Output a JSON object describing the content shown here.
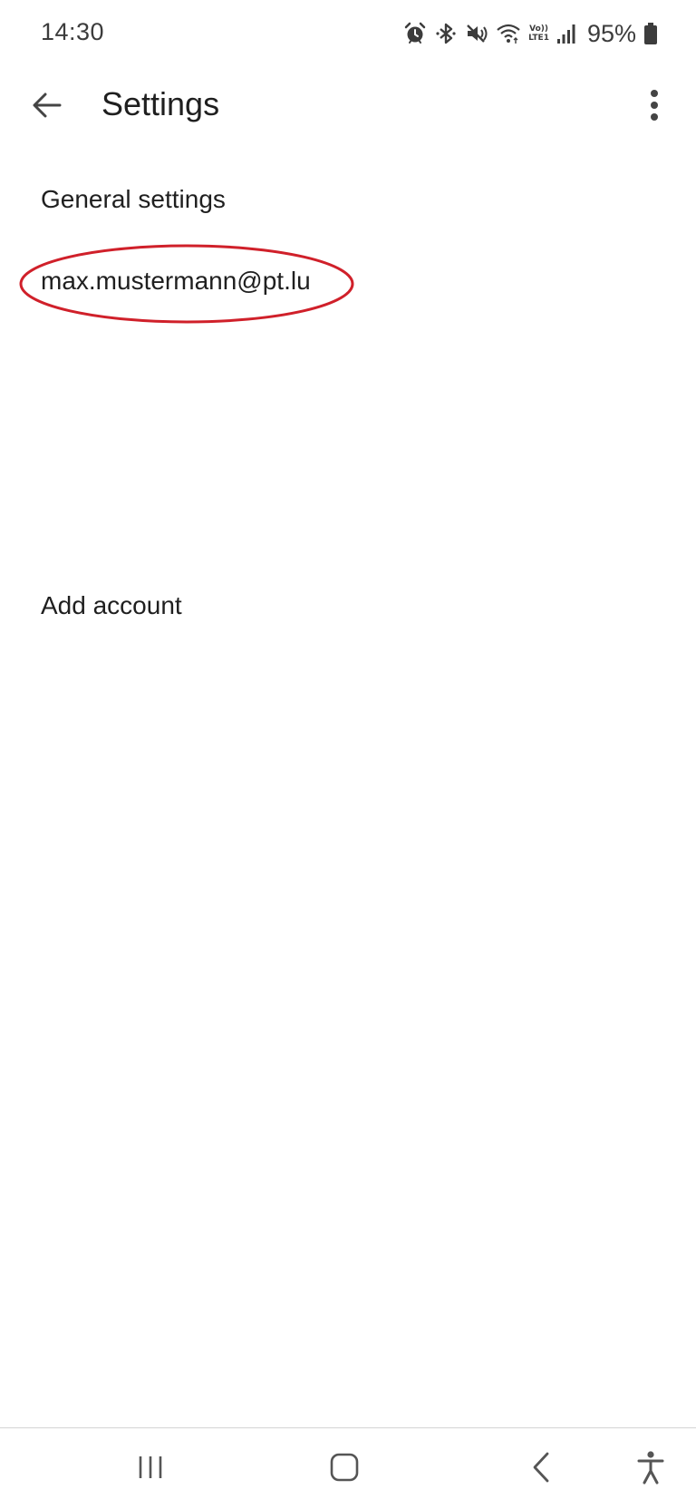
{
  "status_bar": {
    "time": "14:30",
    "battery_percent": "95%",
    "volte_label_top": "Vo))",
    "volte_label_bottom": "LTE1",
    "icons": [
      "alarm-icon",
      "bluetooth-icon",
      "mute-icon",
      "wifi-icon",
      "volte-icon",
      "signal-icon",
      "battery-icon"
    ]
  },
  "app_bar": {
    "title": "Settings",
    "back_icon": "arrow-left-icon",
    "more_icon": "more-vertical-icon"
  },
  "settings_list": {
    "items": [
      {
        "label": "General settings"
      },
      {
        "label": "max.mustermann@pt.lu",
        "highlighted": true,
        "highlight_color": "#d0202a"
      },
      {
        "label": "Add account"
      }
    ]
  },
  "nav_bar": {
    "buttons": [
      "recents-icon",
      "home-icon",
      "back-icon",
      "accessibility-icon"
    ]
  }
}
